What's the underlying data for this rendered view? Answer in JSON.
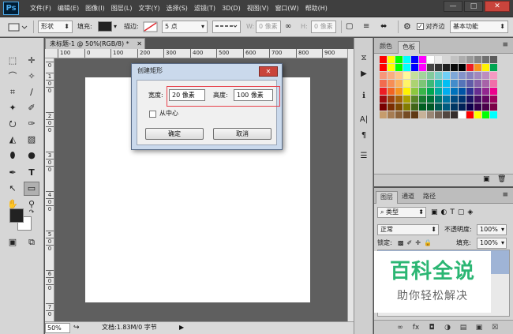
{
  "app": {
    "logo": "Ps",
    "menu": [
      "文件(F)",
      "编辑(E)",
      "图像(I)",
      "图层(L)",
      "文字(Y)",
      "选择(S)",
      "滤镜(T)",
      "3D(D)",
      "视图(V)",
      "窗口(W)",
      "帮助(H)"
    ],
    "window_controls": {
      "minimize": "—",
      "maximize": "□",
      "close": "✕"
    }
  },
  "options_bar": {
    "mode": "形状",
    "fill_label": "填充:",
    "stroke_label": "描边:",
    "stroke_width": "5 点",
    "w_label": "W:",
    "w_value": "0 像素",
    "h_label": "H:",
    "h_value": "0 像素",
    "align_edges": "对齐边",
    "workspace": "基本功能"
  },
  "document": {
    "tab_title": "未标题-1 @ 50%(RGB/8) *",
    "ruler_top": [
      "100",
      "0",
      "100",
      "200",
      "300",
      "400",
      "500",
      "600",
      "700",
      "800",
      "900"
    ],
    "ruler_left": [
      "0",
      "1",
      "0",
      "0",
      "2",
      "0",
      "0",
      "3",
      "0",
      "0",
      "4",
      "0",
      "0",
      "5",
      "0",
      "0",
      "6",
      "0",
      "0",
      "7",
      "0",
      "0"
    ],
    "zoom": "50%",
    "doc_info": "文档:1.83M/0 字节"
  },
  "swatches_panel": {
    "tabs": [
      "颜色",
      "色板"
    ],
    "active_tab": "色板",
    "colors": [
      "#ff0000",
      "#ffff00",
      "#00ff00",
      "#00ffff",
      "#0000ff",
      "#ff00ff",
      "#ffffff",
      "#ebebeb",
      "#d6d6d6",
      "#c2c2c2",
      "#adadad",
      "#999999",
      "#858585",
      "#707070",
      "#5c5c5c",
      "#ff0000",
      "#ffff00",
      "#00ff00",
      "#00ffff",
      "#0000ff",
      "#ff00ff",
      "#474747",
      "#333333",
      "#1f1f1f",
      "#0a0a0a",
      "#000000",
      "#ee1d24",
      "#f7941d",
      "#fff200",
      "#00a651",
      "#f7977a",
      "#f9ad81",
      "#fdc68a",
      "#fff79a",
      "#c4df9b",
      "#a3d39c",
      "#82ca9d",
      "#7bcdc8",
      "#6ecff6",
      "#7ea7d8",
      "#8493ca",
      "#8882be",
      "#a187be",
      "#bc8dbf",
      "#f49ac2",
      "#f26c4f",
      "#f68e55",
      "#fbaf5c",
      "#fff467",
      "#acd372",
      "#7cc576",
      "#3bb878",
      "#1abbb4",
      "#00bff3",
      "#438ccb",
      "#5574b9",
      "#605ca8",
      "#855fa8",
      "#a763a8",
      "#f06ea9",
      "#ed1c24",
      "#f26522",
      "#f7941d",
      "#fff200",
      "#8dc73f",
      "#39b54a",
      "#00a651",
      "#00a99d",
      "#00aeef",
      "#0072bc",
      "#0054a6",
      "#2e3192",
      "#662d91",
      "#92278f",
      "#ec008c",
      "#9e0b0f",
      "#a0410d",
      "#a36209",
      "#aba000",
      "#598527",
      "#197b30",
      "#007236",
      "#00746b",
      "#0076a3",
      "#004a80",
      "#003471",
      "#1b1464",
      "#440e62",
      "#630460",
      "#9e005d",
      "#790000",
      "#7b2e00",
      "#7d4900",
      "#827b00",
      "#406618",
      "#005e20",
      "#005826",
      "#005952",
      "#005b7f",
      "#003663",
      "#002157",
      "#0d004c",
      "#32004b",
      "#4b0049",
      "#7b0046",
      "#c69c6d",
      "#a67c52",
      "#8c6239",
      "#754c24",
      "#603913",
      "#c7b299",
      "#998675",
      "#736357",
      "#534741",
      "#362f2d",
      "#ffffff",
      "#ff0000",
      "#ffff00",
      "#00ff00",
      "#00ffff"
    ]
  },
  "layers_panel": {
    "tabs": [
      "图层",
      "通道",
      "路径"
    ],
    "active_tab": "图层",
    "filter": "类型",
    "blend_mode": "正常",
    "opacity_label": "不透明度:",
    "opacity": "100%",
    "lock_label": "锁定:",
    "fill_label": "填充:",
    "fill": "100%"
  },
  "dialog": {
    "title": "创建矩形",
    "width_label": "宽度:",
    "width_value": "20 像素",
    "height_label": "高度:",
    "height_value": "100 像素",
    "from_center_label": "从中心",
    "from_center_checked": false,
    "ok_label": "确定",
    "cancel_label": "取消",
    "highlight_color": "#e8414b"
  },
  "watermark": {
    "title": "百科全说",
    "subtitle": "助你轻松解决",
    "color": "#2bb673"
  }
}
